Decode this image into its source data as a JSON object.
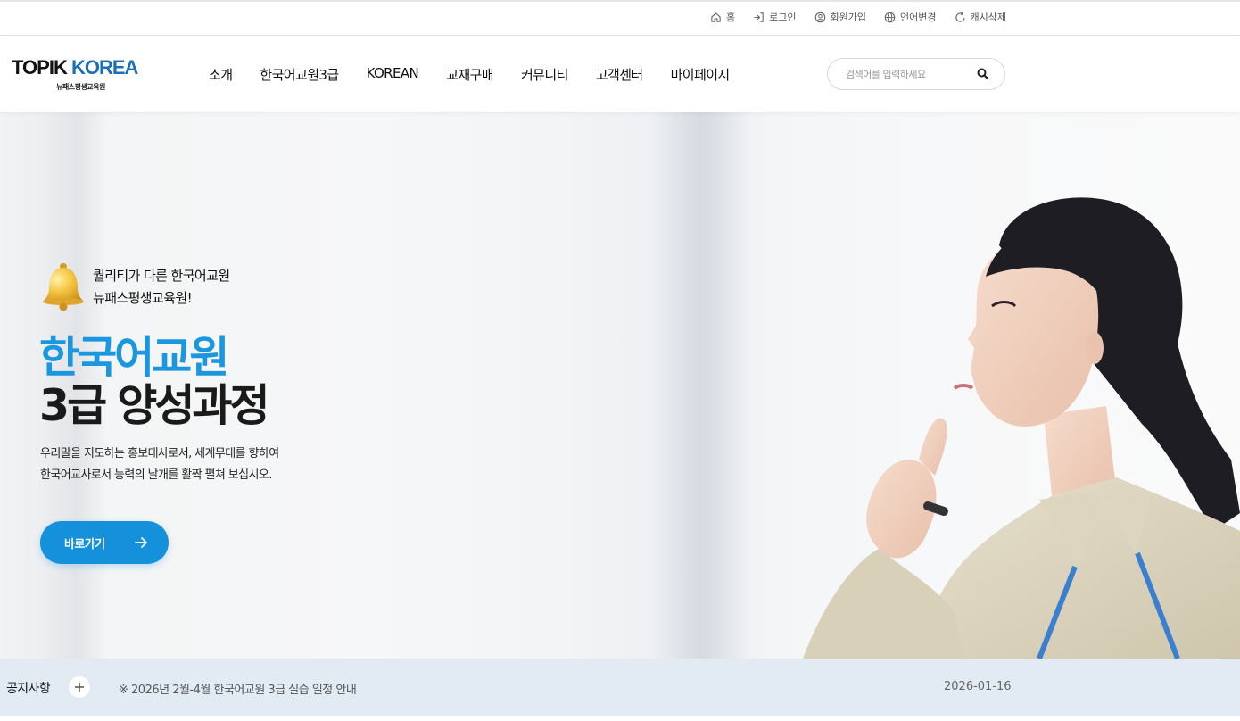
{
  "util_links": [
    {
      "label": "홈",
      "icon": "home-icon"
    },
    {
      "label": "로그인",
      "icon": "login-icon"
    },
    {
      "label": "회원가입",
      "icon": "user-circle-icon"
    },
    {
      "label": "언어변경",
      "icon": "globe-icon"
    },
    {
      "label": "캐시삭제",
      "icon": "refresh-icon"
    }
  ],
  "logo": {
    "main_1": "TOPIK",
    "main_2": " KOREA",
    "sub": "뉴패스평생교육원"
  },
  "nav": [
    "소개",
    "한국어교원3급",
    "KOREAN",
    "교재구매",
    "커뮤니티",
    "고객센터",
    "마이페이지"
  ],
  "search": {
    "placeholder": "검색어를 입력하세요",
    "value": ""
  },
  "hero": {
    "tag_line_1": "퀄리티가 다른 한국어교원",
    "tag_line_2": "뉴패스평생교육원!",
    "title_line_1": "한국어교원",
    "title_line_2": "3급 양성과정",
    "desc_line_1": "우리말을 지도하는 홍보대사로서, 세계무대를 향하여",
    "desc_line_2": "한국어교사로서 능력의 날개를 활짝 펼쳐 보십시오.",
    "button_label": "바로가기"
  },
  "notice": {
    "label": "공지사항",
    "title": "※ 2026년 2월-4월 한국어교원 3급 실습 일정 안내",
    "date": "2026-01-16"
  },
  "colors": {
    "accent": "#1591dc",
    "title_blue": "#1b97e0",
    "logo_blue": "#1b6fb8",
    "notice_bg": "#e0e8f3"
  }
}
